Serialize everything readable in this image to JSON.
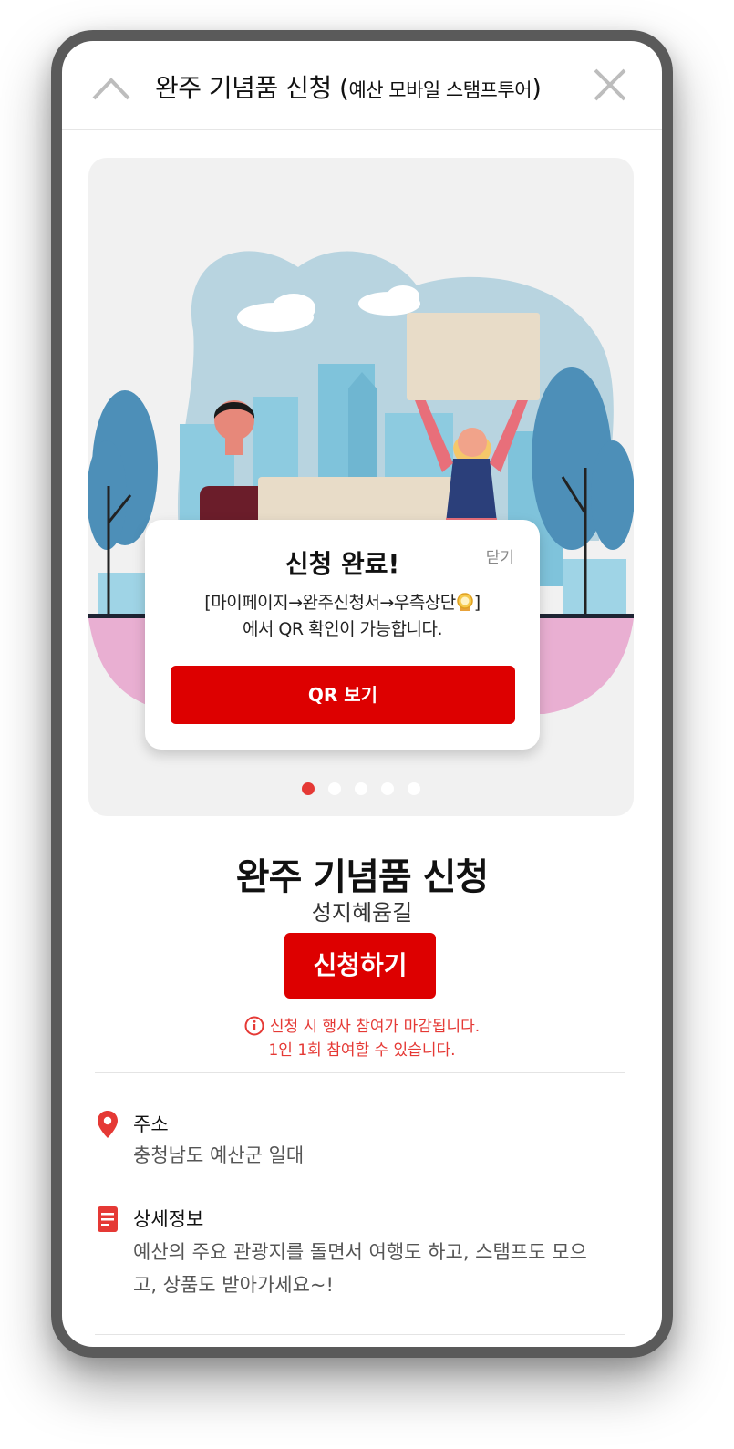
{
  "header": {
    "title": "완주 기념품 신청",
    "subtitle": "예산 모바일 스탬프투어"
  },
  "modal": {
    "title": "신청 완료!",
    "close_label": "닫기",
    "message_line1_pre": "[마이페이지→완주신청서→우측상단",
    "message_line1_post": "]",
    "message_line2": "에서 QR 확인이 가능합니다.",
    "button_label": "QR 보기"
  },
  "carousel": {
    "total": 5,
    "active": 1
  },
  "product": {
    "title": "완주 기념품 신청",
    "subtitle": "성지혜윰길",
    "apply_label": "신청하기"
  },
  "notice": {
    "line1": "신청 시 행사 참여가 마감됩니다.",
    "line2": "1인 1회 참여할 수 있습니다."
  },
  "address": {
    "label": "주소",
    "value": "충청남도 예산군 일대"
  },
  "details": {
    "label": "상세정보",
    "line1": "예산의 주요 관광지를 돌면서 여행도 하고, 스탬프도 모으",
    "line2": "고, 상품도 받아가세요~!"
  },
  "colors": {
    "accent": "#dd0000",
    "notice": "#e53935",
    "frame": "#5a5a5a"
  }
}
